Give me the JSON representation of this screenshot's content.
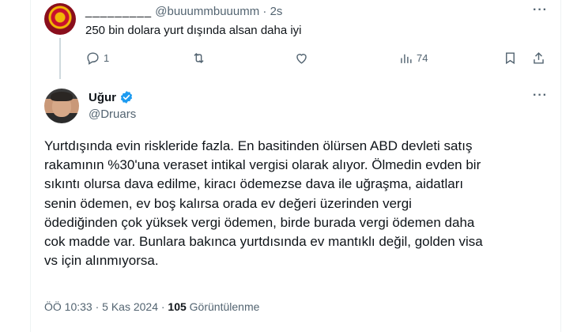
{
  "reply": {
    "name": "_________",
    "handle": "@buuummbuuumm",
    "separator": "·",
    "time": "2s",
    "text": "250 bin dolara yurt dışında alsan daha iyi",
    "more_label": "···",
    "actions": {
      "reply_count": "1",
      "retweet_count": "",
      "like_count": "",
      "views_count": "74"
    }
  },
  "tweet": {
    "name": "Uğur",
    "handle": "@Druars",
    "more_label": "···",
    "body_lines": [
      "Yurtdışında evin riskleride fazla. En basitinden ölürsen ABD devleti satış",
      "rakamının %30'una veraset intikal vergisi olarak alıyor. Ölmedin evden bir",
      "sıkıntı olursa dava edilme, kiracı ödemezse dava ile uğraşma, aidatları",
      "senin ödemen, ev boş kalırsa orada ev değeri üzerinden vergi",
      "ödediğinden çok yüksek vergi ödemen, birde burada vergi ödemen daha",
      "cok madde var. Bunlara bakınca yurtdısında ev mantıklı değil, golden visa",
      "vs için alınmıyorsa."
    ],
    "timestamp": "ÖÖ 10:33 · 5 Kas 2024 ·",
    "views_number": "105",
    "views_label": "Görüntülenme"
  },
  "colors": {
    "verified": "#1d9bf0",
    "muted": "#536471",
    "text": "#0f1419"
  },
  "icons": [
    "reply-icon",
    "retweet-icon",
    "like-icon",
    "views-icon",
    "bookmark-icon",
    "share-icon",
    "more-icon",
    "verified-badge-icon"
  ]
}
